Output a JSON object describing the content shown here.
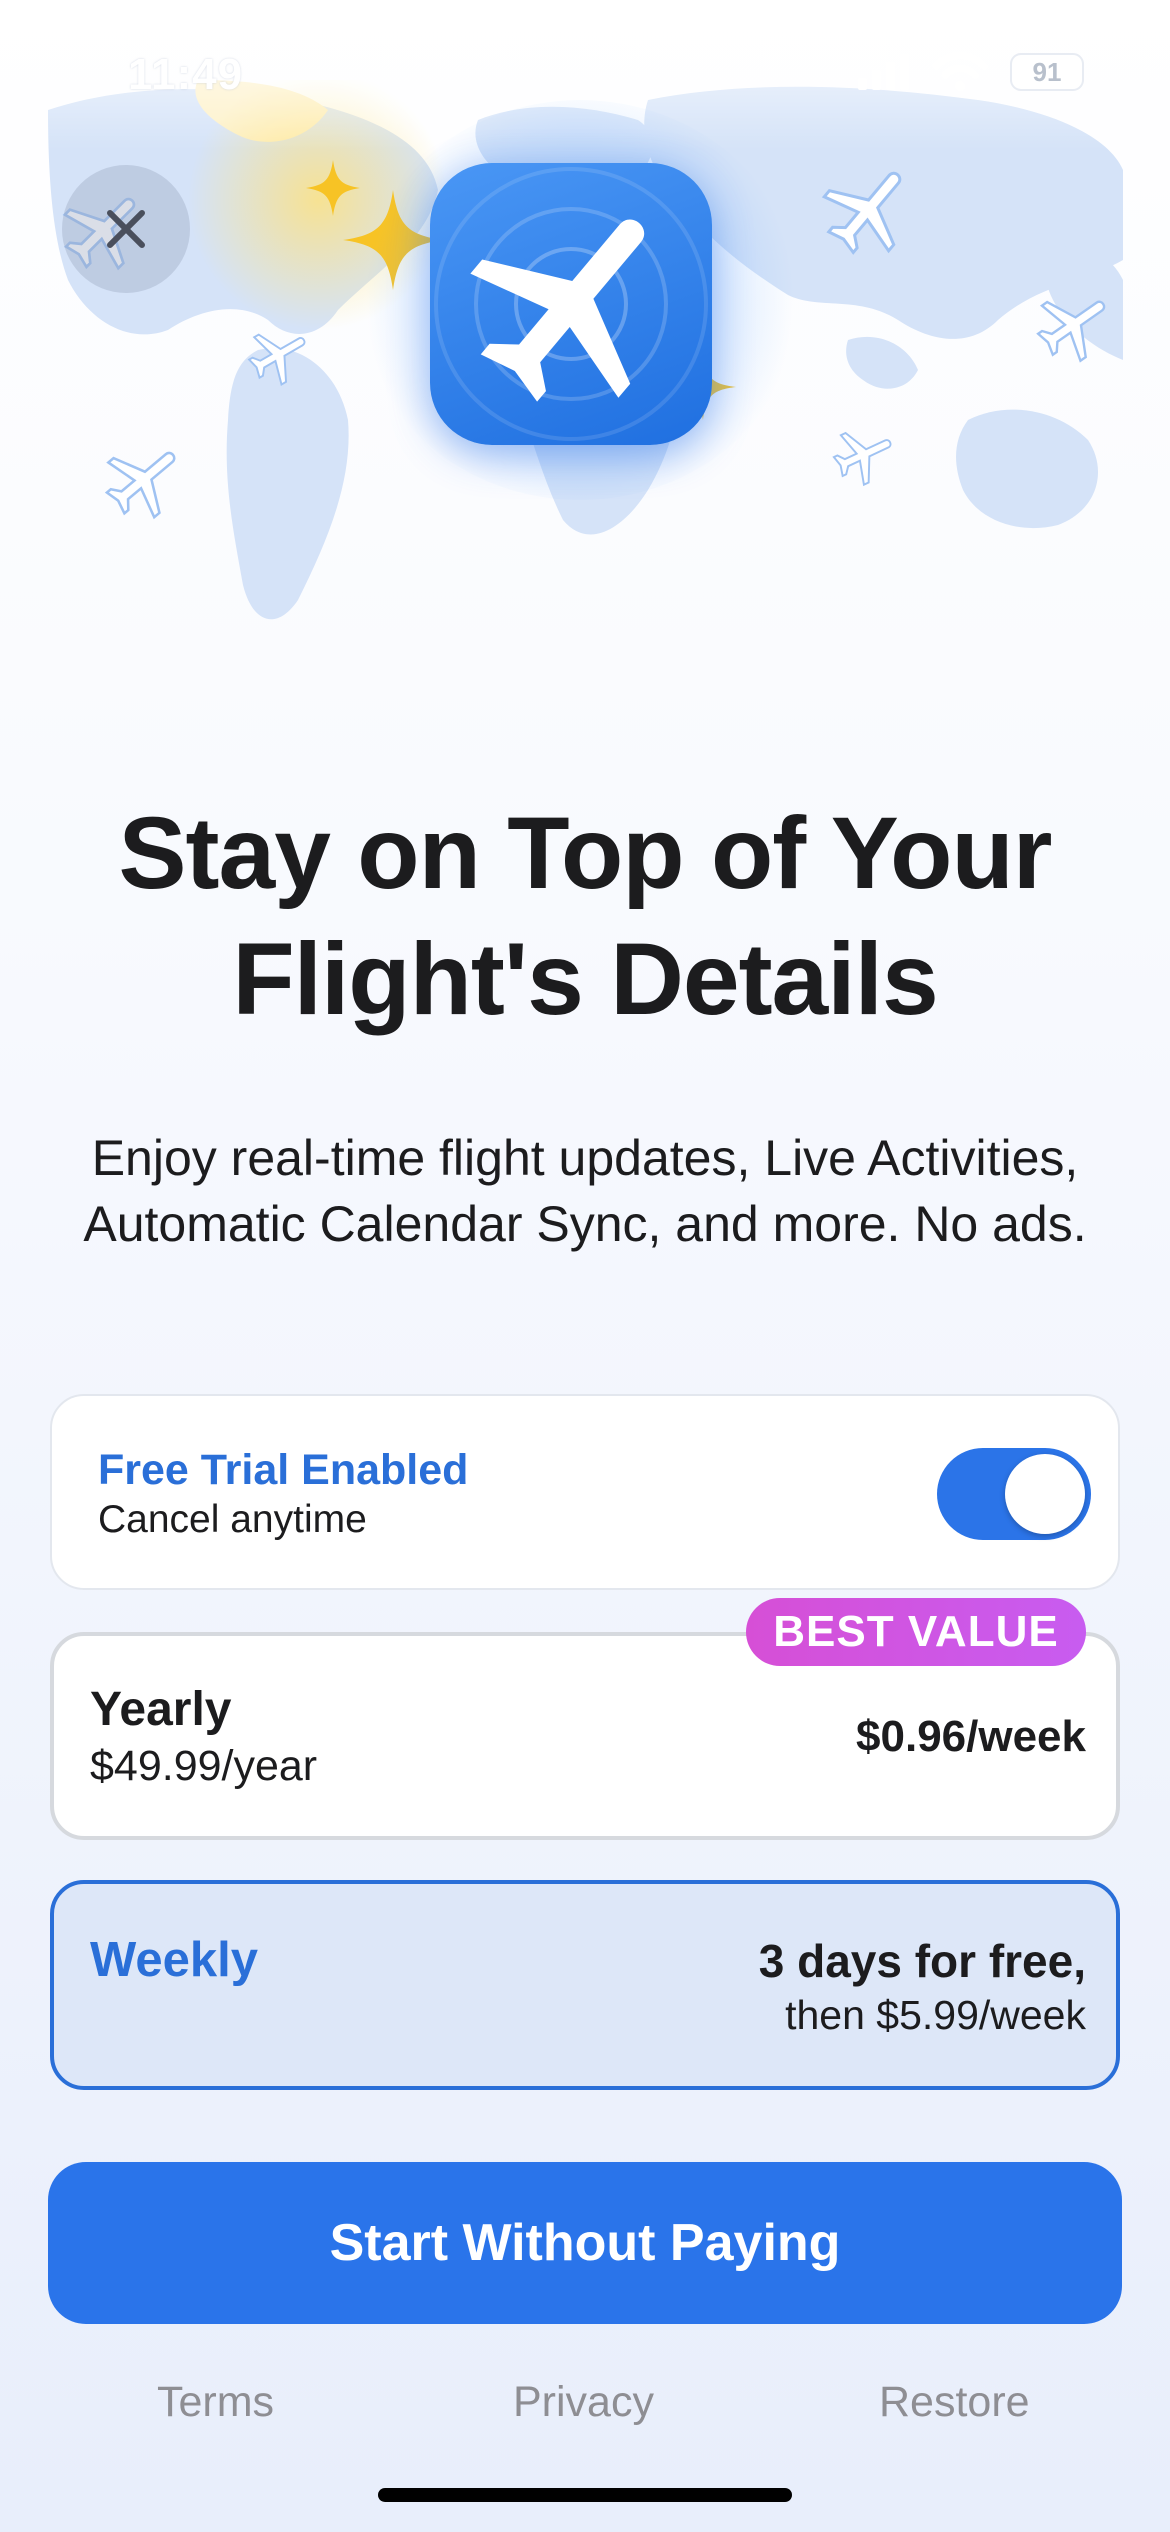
{
  "status_bar": {
    "time": "11:49",
    "battery": "91"
  },
  "hero": {
    "close_icon": "close-icon",
    "app_icon": "airplane-app-icon"
  },
  "headline": "Stay on Top of Your Flight's Details",
  "subtitle": "Enjoy real-time flight updates, Live Activities, Automatic Calendar Sync, and more. No ads.",
  "trial": {
    "title": "Free Trial Enabled",
    "subtitle": "Cancel anytime",
    "enabled": true
  },
  "plans": {
    "yearly": {
      "badge": "BEST VALUE",
      "name": "Yearly",
      "price": "$49.99/year",
      "per_week": "$0.96/week",
      "selected": false
    },
    "weekly": {
      "name": "Weekly",
      "offer": "3 days for free,",
      "then": "then $5.99/week",
      "selected": true
    }
  },
  "cta": {
    "label": "Start Without Paying"
  },
  "footer": {
    "terms": "Terms",
    "privacy": "Privacy",
    "restore": "Restore"
  },
  "colors": {
    "accent": "#2a74ea",
    "badge": "#d64fd6",
    "selected_bg": "#dde7f8",
    "star": "#f7c325"
  }
}
